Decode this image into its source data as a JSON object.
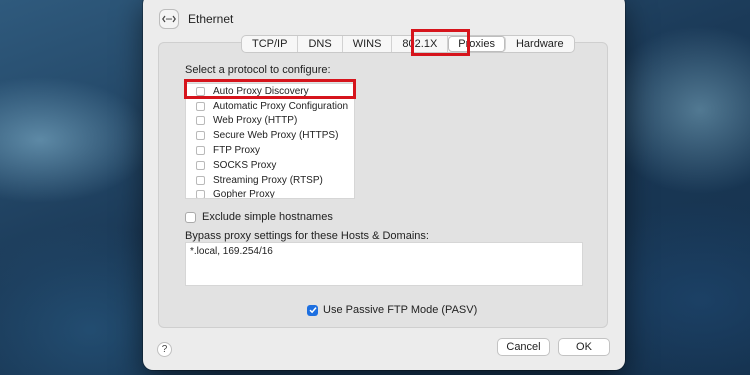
{
  "window": {
    "title": "Ethernet"
  },
  "tabs": [
    {
      "label": "TCP/IP"
    },
    {
      "label": "DNS"
    },
    {
      "label": "WINS"
    },
    {
      "label": "802.1X"
    },
    {
      "label": "Proxies"
    },
    {
      "label": "Hardware"
    }
  ],
  "active_tab": "Proxies",
  "protocol_section": {
    "label": "Select a protocol to configure:",
    "items": [
      {
        "label": "Auto Proxy Discovery",
        "checked": false
      },
      {
        "label": "Automatic Proxy Configuration",
        "checked": false
      },
      {
        "label": "Web Proxy (HTTP)",
        "checked": false
      },
      {
        "label": "Secure Web Proxy (HTTPS)",
        "checked": false
      },
      {
        "label": "FTP Proxy",
        "checked": false
      },
      {
        "label": "SOCKS Proxy",
        "checked": false
      },
      {
        "label": "Streaming Proxy (RTSP)",
        "checked": false
      },
      {
        "label": "Gopher Proxy",
        "checked": false
      }
    ]
  },
  "exclude_simple_hostnames": {
    "label": "Exclude simple hostnames",
    "checked": false
  },
  "bypass": {
    "label": "Bypass proxy settings for these Hosts & Domains:",
    "value": "*.local, 169.254/16"
  },
  "passive_ftp": {
    "label": "Use Passive FTP Mode (PASV)",
    "checked": true
  },
  "buttons": {
    "help": "?",
    "cancel": "Cancel",
    "ok": "OK"
  },
  "colors": {
    "highlight": "#d6141c",
    "checkbox_checked": "#1d6fe0"
  },
  "icons": {
    "window": "ethernet-icon"
  }
}
